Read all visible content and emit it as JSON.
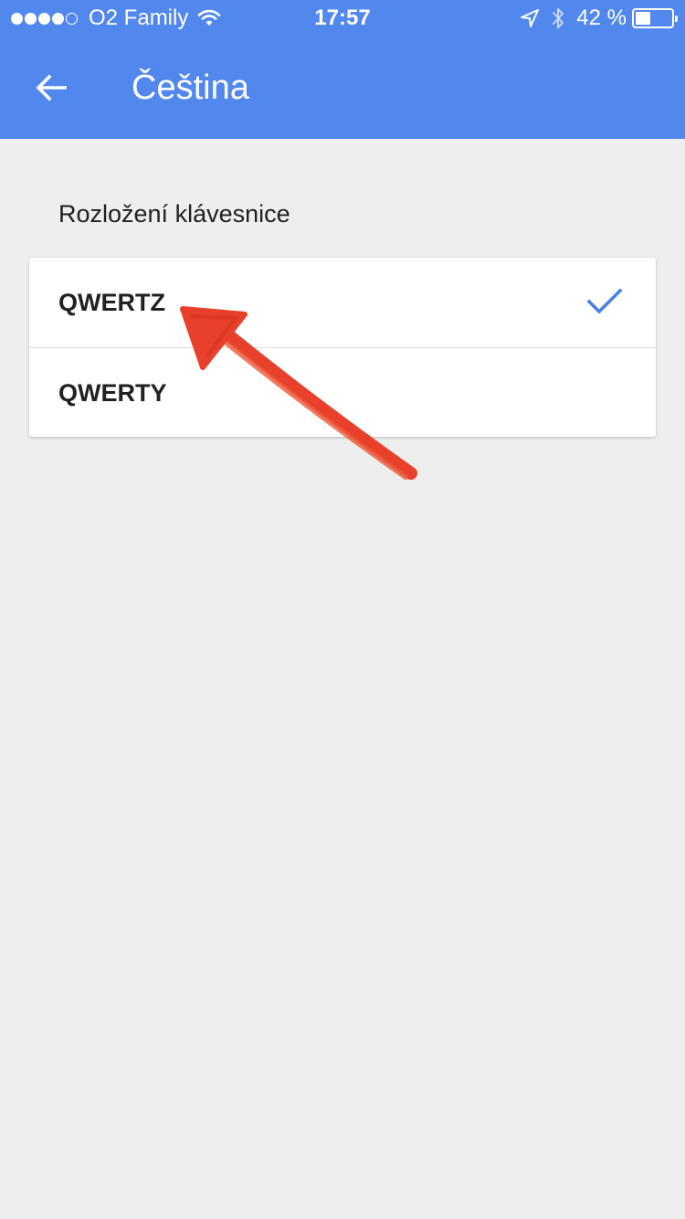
{
  "status_bar": {
    "carrier": "O2 Family",
    "time": "17:57",
    "battery_percent": "42 %",
    "battery_level": 0.42,
    "signal_bars_filled": 4,
    "signal_bars_total": 5,
    "icons": [
      "wifi-icon",
      "location-arrow-icon",
      "bluetooth-icon",
      "battery-icon"
    ]
  },
  "appbar": {
    "title": "Čeština",
    "back_icon": "arrow-left-icon",
    "color": "#5287ee"
  },
  "section": {
    "title": "Rozložení klávesnice"
  },
  "layout_options": [
    {
      "label": "QWERTZ",
      "selected": true
    },
    {
      "label": "QWERTY",
      "selected": false
    }
  ],
  "colors": {
    "accent": "#5287ee",
    "check": "#4a7fe4",
    "annotation": "#e8402a",
    "background": "#eeeeee"
  }
}
